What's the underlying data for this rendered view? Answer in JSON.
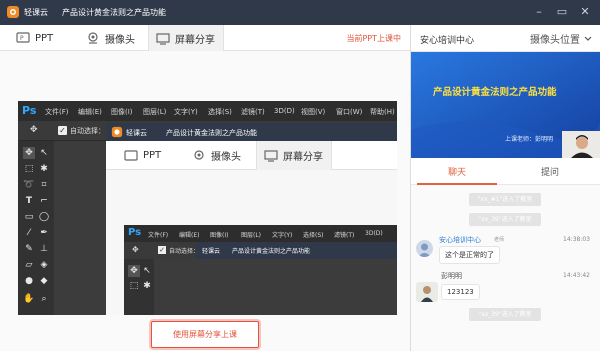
{
  "titlebar": {
    "brand": "轻课云",
    "course_title": "产品设计黄金法则之产品功能",
    "controls": [
      "minimize-icon",
      "maximize-icon",
      "close-icon"
    ]
  },
  "tabs": [
    {
      "label": "PPT",
      "icon": "ppt-icon",
      "active": false
    },
    {
      "label": "摄像头",
      "icon": "camera-icon",
      "active": false
    },
    {
      "label": "屏幕分享",
      "icon": "monitor-icon",
      "active": true
    }
  ],
  "status_link": "当前PPT上课中",
  "share_button": "使用屏幕分享上课",
  "photoshop": {
    "logo": "Ps",
    "menus": [
      "文件(F)",
      "编辑(E)",
      "图像(I)",
      "图层(L)",
      "文字(Y)",
      "选择(S)",
      "滤镜(T)",
      "3D(D)",
      "视图(V)",
      "窗口(W)",
      "帮助(H)"
    ],
    "auto_select_label": "自动选择：",
    "nested_menus": [
      "文件(F)",
      "编辑(E)",
      "图像(I)",
      "图层(L)",
      "文字(Y)",
      "选择(S)",
      "滤镜(T)",
      "3D(D)"
    ]
  },
  "right_panel": {
    "org_name": "安心培训中心",
    "camera_position_label": "摄像头位置",
    "video_title": "产品设计黄金法则之产品功能",
    "video_teacher": "上课老师：彭明明",
    "tabs": [
      {
        "label": "聊天",
        "active": true
      },
      {
        "label": "提问",
        "active": false
      }
    ],
    "chat": [
      {
        "type": "system",
        "text": "\"xx_#1\"进入了教室"
      },
      {
        "type": "system",
        "text": "\"xx_39\"进入了教室"
      },
      {
        "type": "message",
        "name": "安心培训中心",
        "role": "老师",
        "time": "14:38:03",
        "text": "这个是正常的了",
        "name_color": "#2b7fd6"
      },
      {
        "type": "message",
        "name": "彭明明",
        "role": "",
        "time": "14:43:42",
        "text": "123123",
        "name_color": "#555555"
      },
      {
        "type": "system",
        "text": "\"xx_39\"进入了教室"
      }
    ]
  },
  "colors": {
    "titlebar": "#2f394a",
    "accent_red": "#e5533c",
    "video_blue": "#1f5ec9",
    "chat_active": "#e0633c"
  }
}
